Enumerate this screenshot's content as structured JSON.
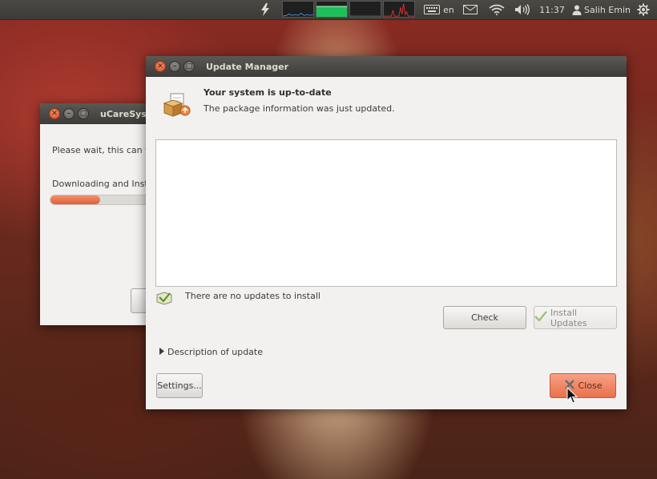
{
  "panel": {
    "keyboard_layout": "en",
    "time": "11:37",
    "user": "Salih Emin",
    "icons": [
      "flash-icon",
      "keyboard-icon",
      "mail-icon",
      "wifi-icon",
      "volume-icon",
      "user-icon",
      "session-gear-icon"
    ]
  },
  "background_window": {
    "title": "uCareSyste",
    "message": "Please wait, this can ta",
    "status": "Downloading and Instal",
    "progress": 0.45
  },
  "update_manager": {
    "title": "Update Manager",
    "heading": "Your system is up-to-date",
    "subheading": "The package information was just updated.",
    "status_text": "There are no updates to install",
    "check_label": "Check",
    "install_label": "Install Updates",
    "description_label": "Description of update",
    "settings_label": "Settings...",
    "close_label": "Close"
  },
  "colors": {
    "accent_orange": "#e9714d",
    "panel_dark": "#3c3b37",
    "window_bg": "#f2f1f0"
  }
}
